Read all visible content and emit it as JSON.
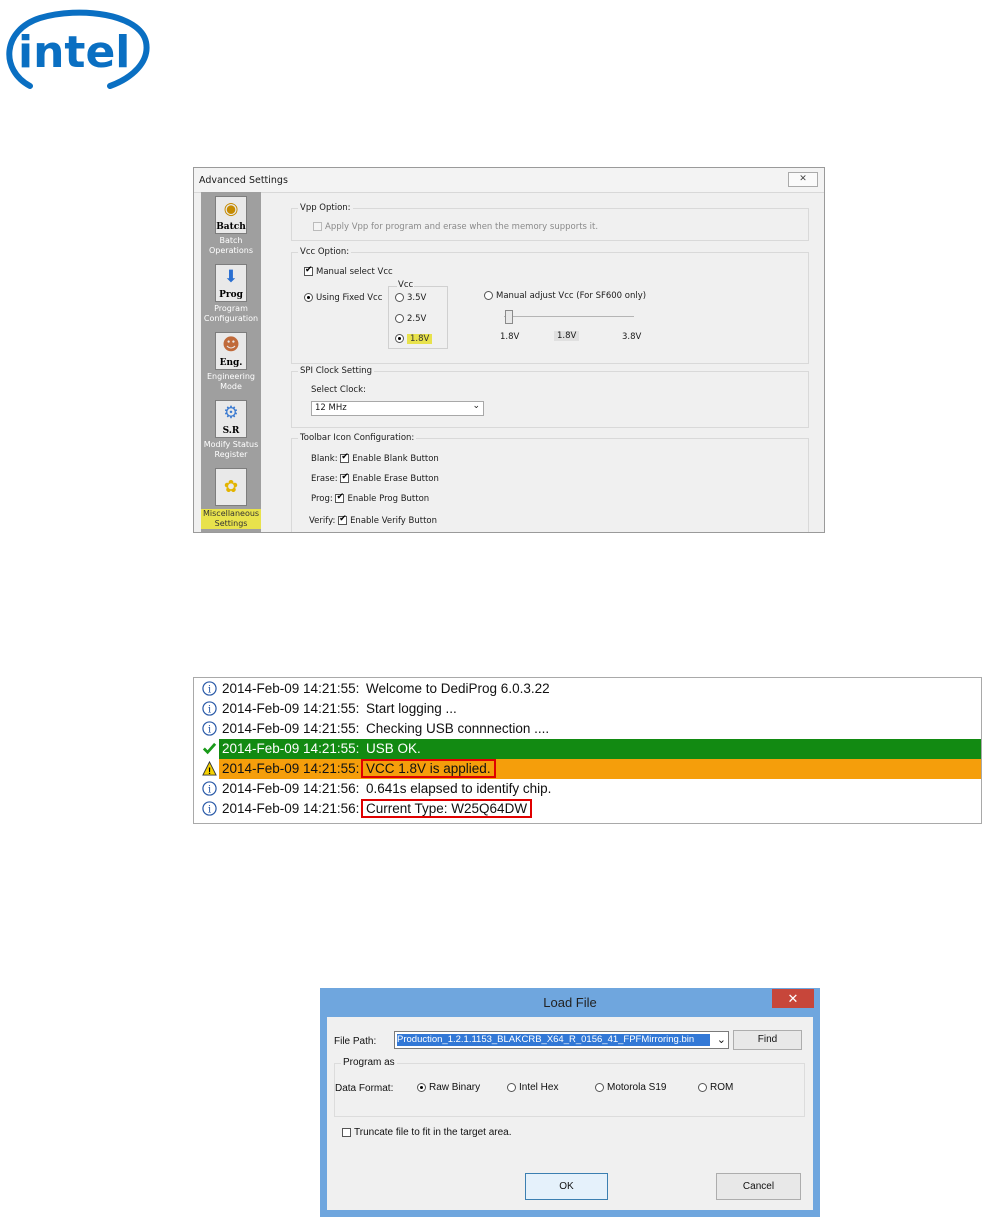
{
  "logo": {
    "text": "intel",
    "color": "#0a6fc2"
  },
  "advanced_settings": {
    "title": "Advanced Settings",
    "close_label": "✕",
    "sidebar": [
      {
        "icon_caption": "Batch",
        "label": "Batch\nOperations"
      },
      {
        "icon_caption": "Prog",
        "label": "Program\nConfiguration"
      },
      {
        "icon_caption": "Eng.",
        "label": "Engineering\nMode"
      },
      {
        "icon_caption": "S.R",
        "label": "Modify Status\nRegister"
      },
      {
        "icon_caption": "",
        "label": "Miscellaneous\nSettings"
      }
    ],
    "vpp": {
      "legend": "Vpp Option:",
      "checkbox_label": "Apply Vpp for program and erase when the memory supports it."
    },
    "vcc": {
      "legend": "Vcc Option:",
      "manual_select_label": "Manual select Vcc",
      "using_fixed_label": "Using Fixed Vcc",
      "vcc_group_label": "Vcc",
      "options": [
        "3.5V",
        "2.5V",
        "1.8V"
      ],
      "selected": "1.8V",
      "manual_adjust_label": "Manual adjust Vcc (For SF600 only)",
      "slider_min": "1.8V",
      "slider_value": "1.8V",
      "slider_max": "3.8V"
    },
    "spi": {
      "legend": "SPI Clock Setting",
      "select_label": "Select Clock:",
      "selected": "12 MHz"
    },
    "toolbar": {
      "legend": "Toolbar Icon Configuration:",
      "rows": [
        {
          "name": "Blank:",
          "label": "Enable Blank Button"
        },
        {
          "name": "Erase:",
          "label": "Enable Erase Button"
        },
        {
          "name": "Prog:",
          "label": "Enable Prog Button"
        },
        {
          "name": "Verify:",
          "label": "Enable Verify Button"
        }
      ]
    }
  },
  "log": {
    "rows": [
      {
        "ts": "2014-Feb-09 14:21:55:",
        "msg": "Welcome to DediProg  6.0.3.22",
        "type": "info"
      },
      {
        "ts": "2014-Feb-09 14:21:55:",
        "msg": "Start logging ...",
        "type": "info"
      },
      {
        "ts": "2014-Feb-09 14:21:55:",
        "msg": "Checking USB connnection ....",
        "type": "info"
      },
      {
        "ts": "2014-Feb-09 14:21:55:",
        "msg": "USB OK.",
        "type": "ok"
      },
      {
        "ts": "2014-Feb-09 14:21:55:",
        "msg": "VCC 1.8V is applied.",
        "type": "warn"
      },
      {
        "ts": "2014-Feb-09 14:21:56:",
        "msg": "0.641s elapsed to identify chip.",
        "type": "info"
      },
      {
        "ts": "2014-Feb-09 14:21:56:",
        "msg": "Current Type: W25Q64DW",
        "type": "info"
      }
    ],
    "colors": {
      "ok": "#128a12",
      "warn": "#f59e0b",
      "highlight_box": "#e00000"
    }
  },
  "load_file": {
    "title": "Load File",
    "close_label": "✕",
    "file_path_label": "File Path:",
    "file_path_value": "Production_1.2.1.1153_BLAKCRB_X64_R_0156_41_FPFMirroring.bin",
    "find_label": "Find",
    "program_as_legend": "Program as",
    "data_format_label": "Data Format:",
    "formats": [
      "Raw Binary",
      "Intel Hex",
      "Motorola S19",
      "ROM"
    ],
    "selected_format": "Raw Binary",
    "truncate_label": "Truncate file to fit in the target area.",
    "ok_label": "OK",
    "cancel_label": "Cancel"
  }
}
